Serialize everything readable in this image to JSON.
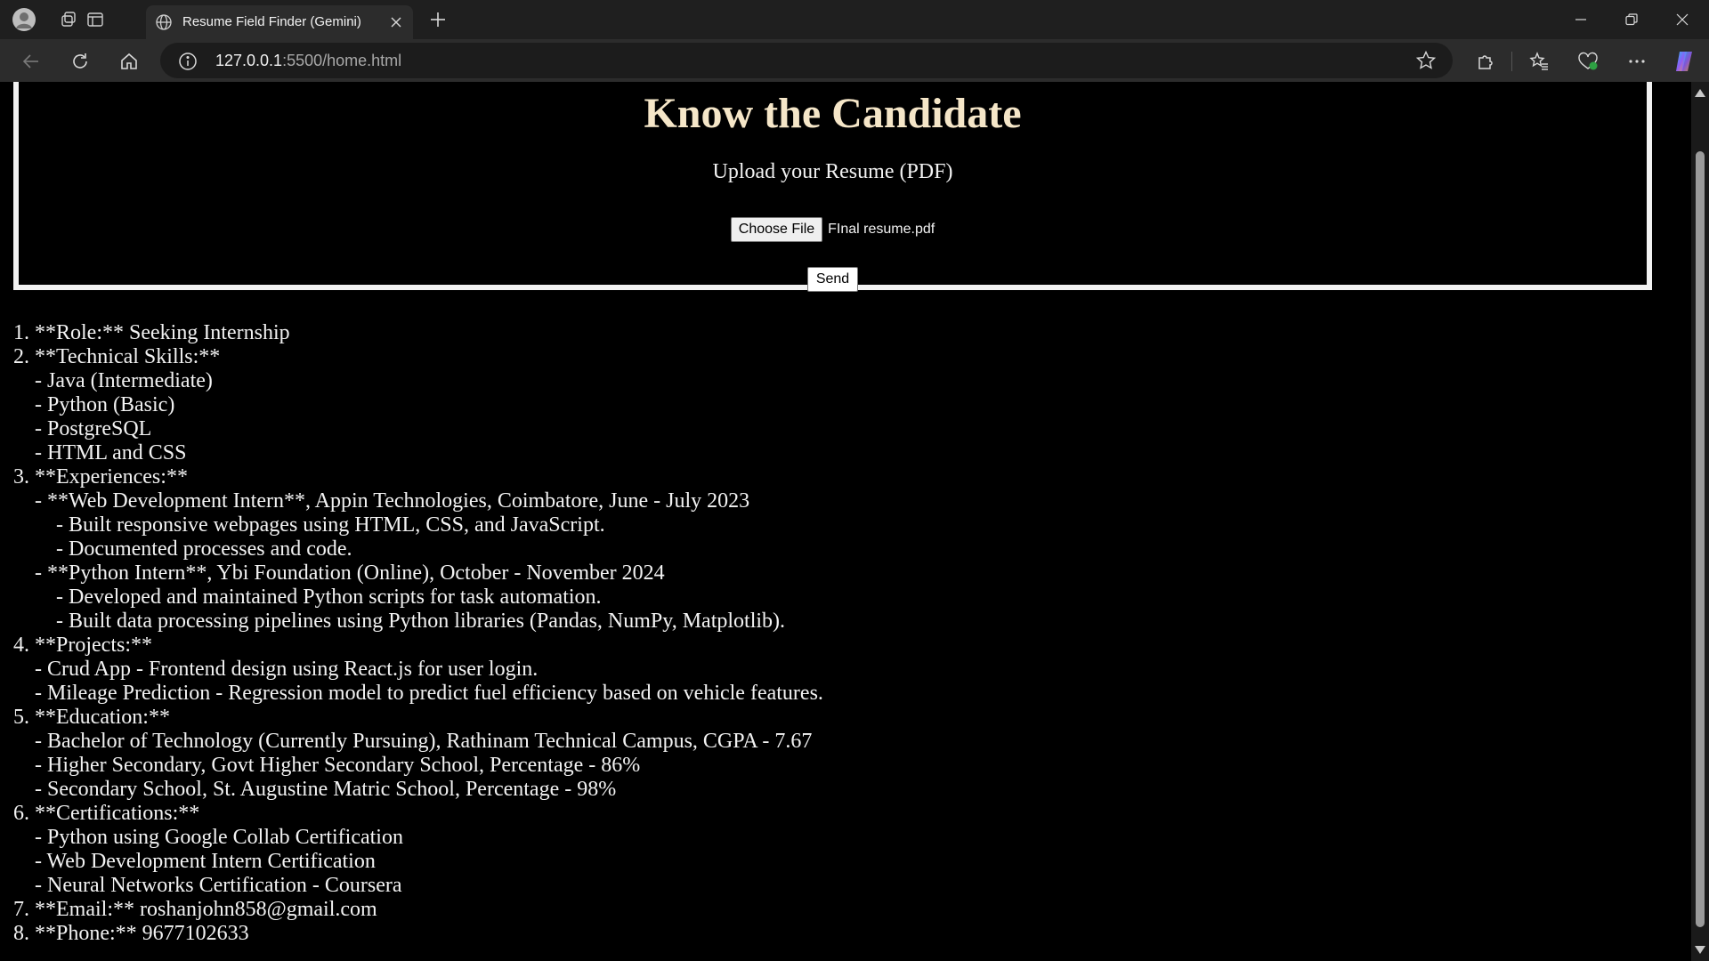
{
  "browser": {
    "tab_title": "Resume Field Finder (Gemini)",
    "url_host": "127.0.0.1",
    "url_path": ":5500/home.html"
  },
  "page": {
    "heading": "Know the Candidate",
    "upload_label": "Upload your Resume (PDF)",
    "choose_file_label": "Choose File",
    "selected_file": "FInal resume.pdf",
    "send_label": "Send"
  },
  "result_lines": [
    "1. **Role:** Seeking Internship",
    "2. **Technical Skills:**",
    "    - Java (Intermediate)",
    "    - Python (Basic)",
    "    - PostgreSQL",
    "    - HTML and CSS",
    "3. **Experiences:**",
    "    - **Web Development Intern**, Appin Technologies, Coimbatore, June - July 2023",
    "        - Built responsive webpages using HTML, CSS, and JavaScript.",
    "        - Documented processes and code.",
    "    - **Python Intern**, Ybi Foundation (Online), October - November 2024",
    "        - Developed and maintained Python scripts for task automation.",
    "        - Built data processing pipelines using Python libraries (Pandas, NumPy, Matplotlib).",
    "4. **Projects:**",
    "    - Crud App - Frontend design using React.js for user login.",
    "    - Mileage Prediction - Regression model to predict fuel efficiency based on vehicle features.",
    "5. **Education:**",
    "    - Bachelor of Technology (Currently Pursuing), Rathinam Technical Campus, CGPA - 7.67",
    "    - Higher Secondary, Govt Higher Secondary School, Percentage - 86%",
    "    - Secondary School, St. Augustine Matric School, Percentage - 98%",
    "6. **Certifications:**",
    "    - Python using Google Collab Certification",
    "    - Web Development Intern Certification",
    "    - Neural Networks Certification - Coursera",
    "7. **Email:** roshanjohn858@gmail.com",
    "8. **Phone:** 9677102633"
  ]
}
